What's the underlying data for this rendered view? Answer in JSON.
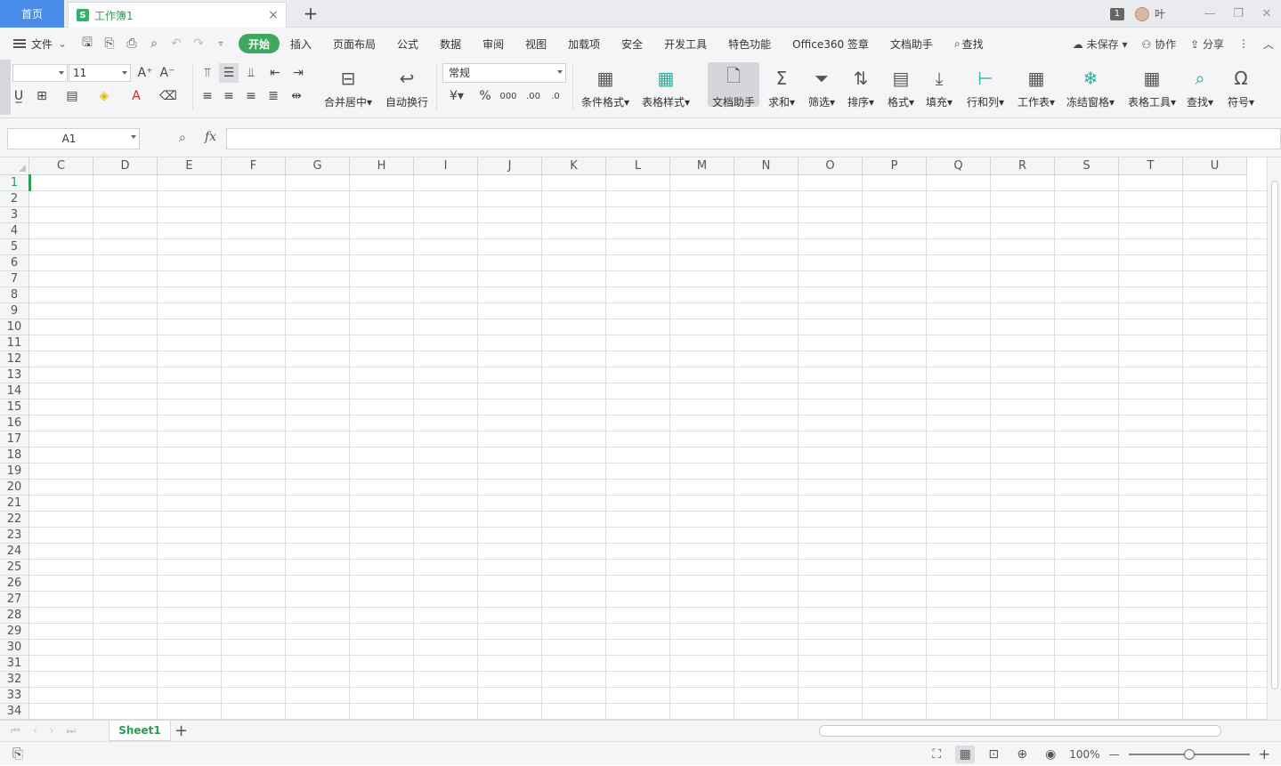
{
  "titlebar": {
    "home_tab": "首页",
    "doc_tab_icon": "S",
    "doc_tab_name": "工作簿1",
    "close_glyph": "×",
    "new_tab_glyph": "+",
    "window_count": "1",
    "user_name": "叶",
    "min_glyph": "—",
    "max_glyph": "❐",
    "close_win_glyph": "✕"
  },
  "menu": {
    "file_label": "文件",
    "tabs": [
      "开始",
      "插入",
      "页面布局",
      "公式",
      "数据",
      "审阅",
      "视图",
      "加载项",
      "安全",
      "开发工具",
      "特色功能",
      "Office360 签章",
      "文档助手",
      "查找"
    ],
    "unsaved": "未保存",
    "collab": "协作",
    "share": "分享"
  },
  "ribbon": {
    "font_size": "11",
    "number_format": "常规",
    "merge_label": "合并居中",
    "wrap_label": "自动换行",
    "cond_format": "条件格式",
    "table_style": "表格样式",
    "doc_assist": "文档助手",
    "sum": "求和",
    "filter": "筛选",
    "sort": "排序",
    "format": "格式",
    "fill": "填充",
    "rowcol": "行和列",
    "worksheet": "工作表",
    "freeze": "冻结窗格",
    "table_tools": "表格工具",
    "find": "查找",
    "symbol": "符号"
  },
  "formula_bar": {
    "name_box": "A1",
    "fx": "fx",
    "formula": ""
  },
  "grid": {
    "columns": [
      "C",
      "D",
      "E",
      "F",
      "G",
      "H",
      "I",
      "J",
      "K",
      "L",
      "M",
      "N",
      "O",
      "P",
      "Q",
      "R",
      "S",
      "T",
      "U"
    ],
    "rows": [
      "1",
      "2",
      "3",
      "4",
      "5",
      "6",
      "7",
      "8",
      "9",
      "10",
      "11",
      "12",
      "13",
      "14",
      "15",
      "16",
      "17",
      "18",
      "19",
      "20",
      "21",
      "22",
      "23",
      "24",
      "25",
      "26",
      "27",
      "28",
      "29",
      "30",
      "31",
      "32",
      "33",
      "34"
    ]
  },
  "sheets": {
    "tabs": [
      "Sheet1"
    ],
    "add_glyph": "+"
  },
  "status": {
    "zoom": "100%",
    "zoom_minus": "—",
    "zoom_plus": "+"
  }
}
